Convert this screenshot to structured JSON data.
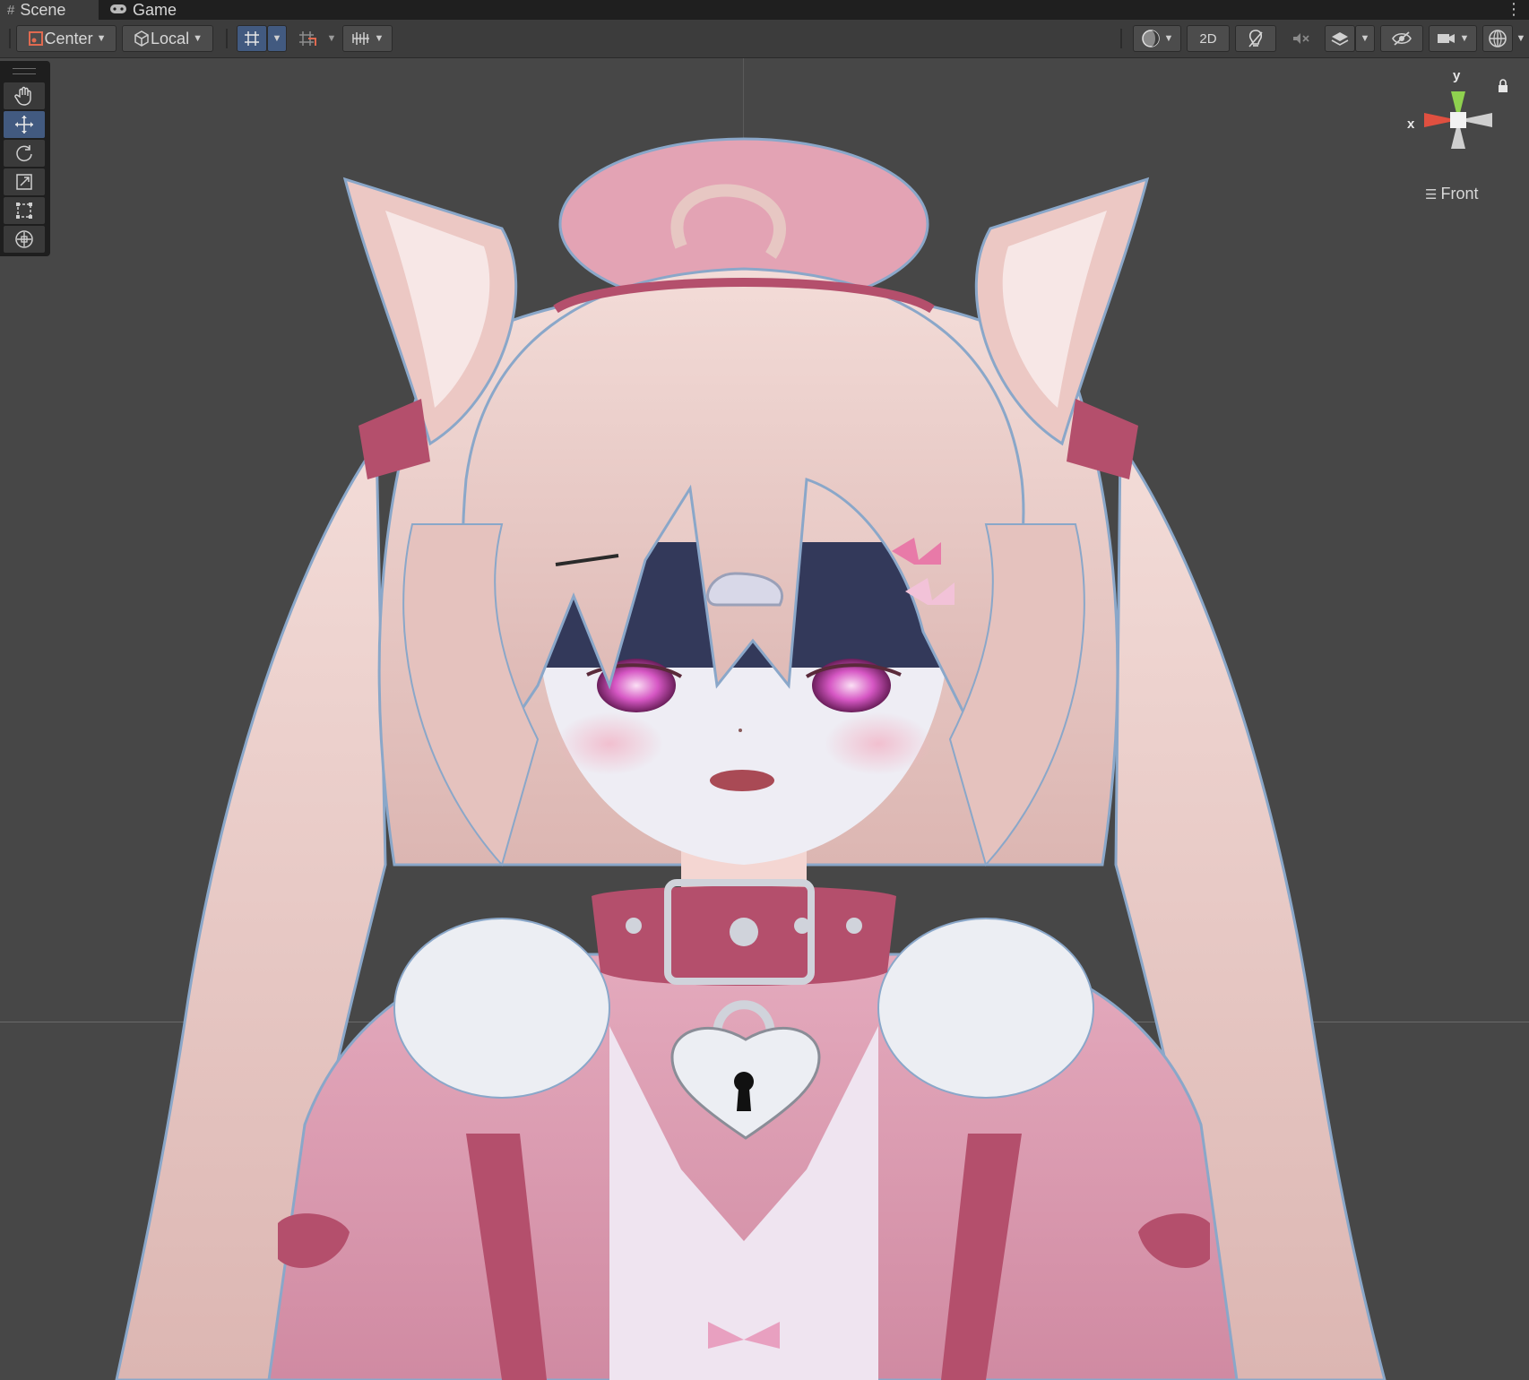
{
  "tabs": [
    {
      "label": "Scene",
      "icon": "scene-grid-icon",
      "active": true
    },
    {
      "label": "Game",
      "icon": "gamepad-icon",
      "active": false
    }
  ],
  "toolbar": {
    "pivot_label": "Center",
    "space_label": "Local",
    "mode_2d_label": "2D"
  },
  "gizmo": {
    "y_label": "y",
    "x_label": "x",
    "view_label": "Front",
    "colors": {
      "y": "#8fd14f",
      "x": "#e05040",
      "z": "#cfcfcf"
    }
  },
  "tools": [
    "hand-tool",
    "move-tool",
    "rotate-tool",
    "scale-tool",
    "rect-tool",
    "transform-tool"
  ],
  "colors": {
    "background": "#474747",
    "selection": "#425a80",
    "hair": "#e9c9c6",
    "accent_pink": "#b44f6c"
  }
}
